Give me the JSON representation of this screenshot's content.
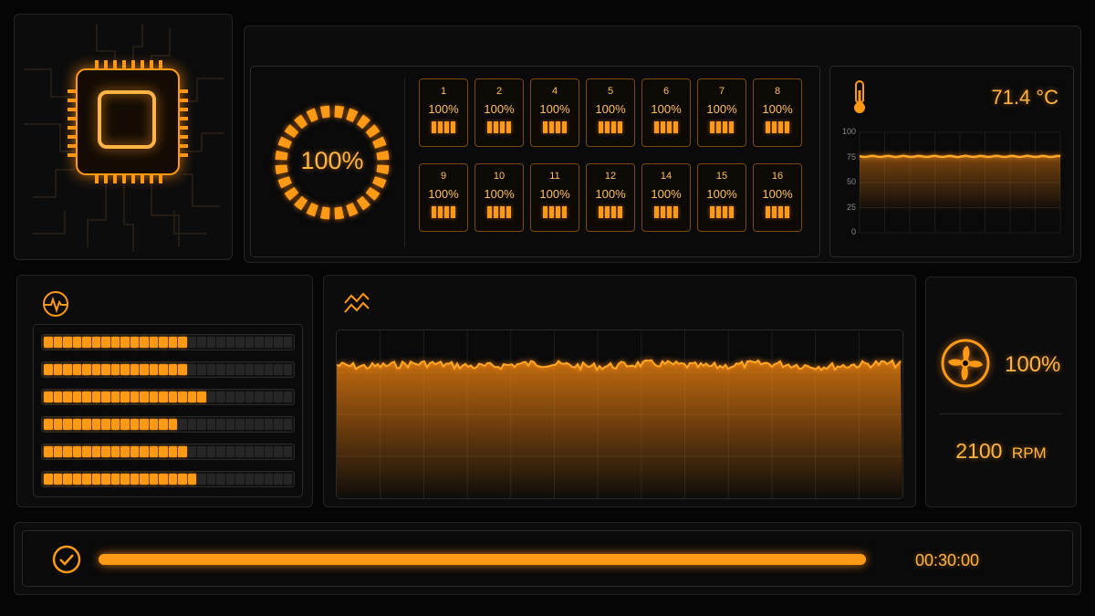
{
  "cpu": {
    "total_load": "100%",
    "total_load_value": 1.0,
    "cores": [
      {
        "id": "1",
        "load": "100%"
      },
      {
        "id": "2",
        "load": "100%"
      },
      {
        "id": "4",
        "load": "100%"
      },
      {
        "id": "5",
        "load": "100%"
      },
      {
        "id": "6",
        "load": "100%"
      },
      {
        "id": "7",
        "load": "100%"
      },
      {
        "id": "8",
        "load": "100%"
      },
      {
        "id": "9",
        "load": "100%"
      },
      {
        "id": "10",
        "load": "100%"
      },
      {
        "id": "11",
        "load": "100%"
      },
      {
        "id": "12",
        "load": "100%"
      },
      {
        "id": "14",
        "load": "100%"
      },
      {
        "id": "15",
        "load": "100%"
      },
      {
        "id": "16",
        "load": "100%"
      }
    ]
  },
  "temperature": {
    "value": "71.4 °C",
    "axis_ticks": [
      "100",
      "75",
      "50",
      "25",
      "0"
    ],
    "series_level": 76
  },
  "load_bars": {
    "levels": [
      0.56,
      0.56,
      0.64,
      0.52,
      0.56,
      0.6
    ]
  },
  "fan": {
    "speed_percent": "100%",
    "rpm_value": "2100",
    "rpm_unit": "RPM"
  },
  "timer": {
    "elapsed": "00:30:00",
    "progress": 1.0
  },
  "icons": {
    "chip": "chip-icon",
    "thermometer": "thermometer-icon",
    "pulse": "pulse-icon",
    "trend": "trend-icon",
    "fan": "fan-icon",
    "check": "check-circle-icon"
  },
  "colors": {
    "accent": "#ff9a17",
    "background": "#050505",
    "panel": "#0c0c0c"
  }
}
